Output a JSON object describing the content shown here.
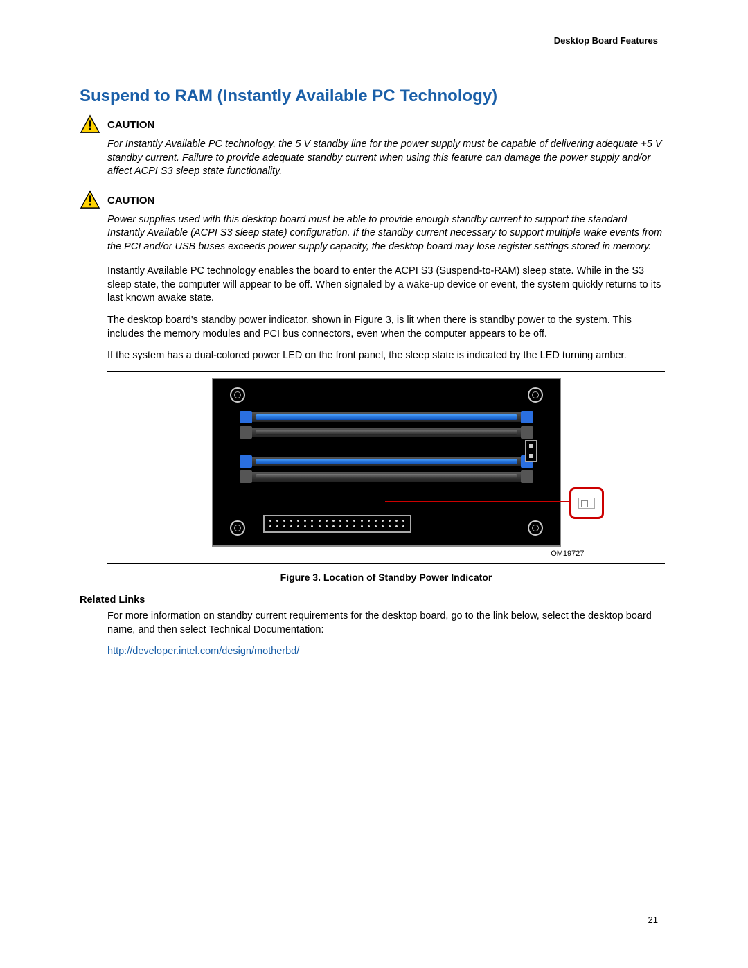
{
  "header": {
    "breadcrumb": "Desktop Board Features"
  },
  "title": "Suspend to RAM (Instantly Available PC Technology)",
  "cautions": [
    {
      "label": "CAUTION",
      "text": "For Instantly Available PC technology, the 5 V standby line for the power supply must be capable of delivering adequate +5 V standby current.  Failure to provide adequate standby current when using this feature can damage the power supply and/or affect ACPI S3 sleep state functionality."
    },
    {
      "label": "CAUTION",
      "text": "Power supplies used with this desktop board must be able to provide enough standby current to support the standard Instantly Available (ACPI S3 sleep state) configuration.  If the standby current necessary to support multiple wake events from the PCI and/or USB buses exceeds power supply capacity, the desktop board may lose register settings stored in memory."
    }
  ],
  "paragraphs": [
    "Instantly Available PC technology enables the board to enter the ACPI S3 (Suspend-to-RAM) sleep state.  While in the S3 sleep state, the computer will appear to be off.  When signaled by a wake-up device or event, the system quickly returns to its last known awake state.",
    "The desktop board's standby power indicator, shown in Figure 3, is lit when there is standby power to the system.  This includes the memory modules and PCI bus connectors, even when the computer appears to be off.",
    "If the system has a dual-colored power LED on the front panel, the sleep state is indicated by the LED turning amber."
  ],
  "figure": {
    "om_label": "OM19727",
    "caption": "Figure 3.  Location of Standby Power Indicator"
  },
  "related": {
    "label": "Related Links",
    "text": "For more information on standby current requirements for the desktop board, go to the link below, select the desktop board name, and then select Technical Documentation:",
    "url": "http://developer.intel.com/design/motherbd/"
  },
  "page_number": "21"
}
